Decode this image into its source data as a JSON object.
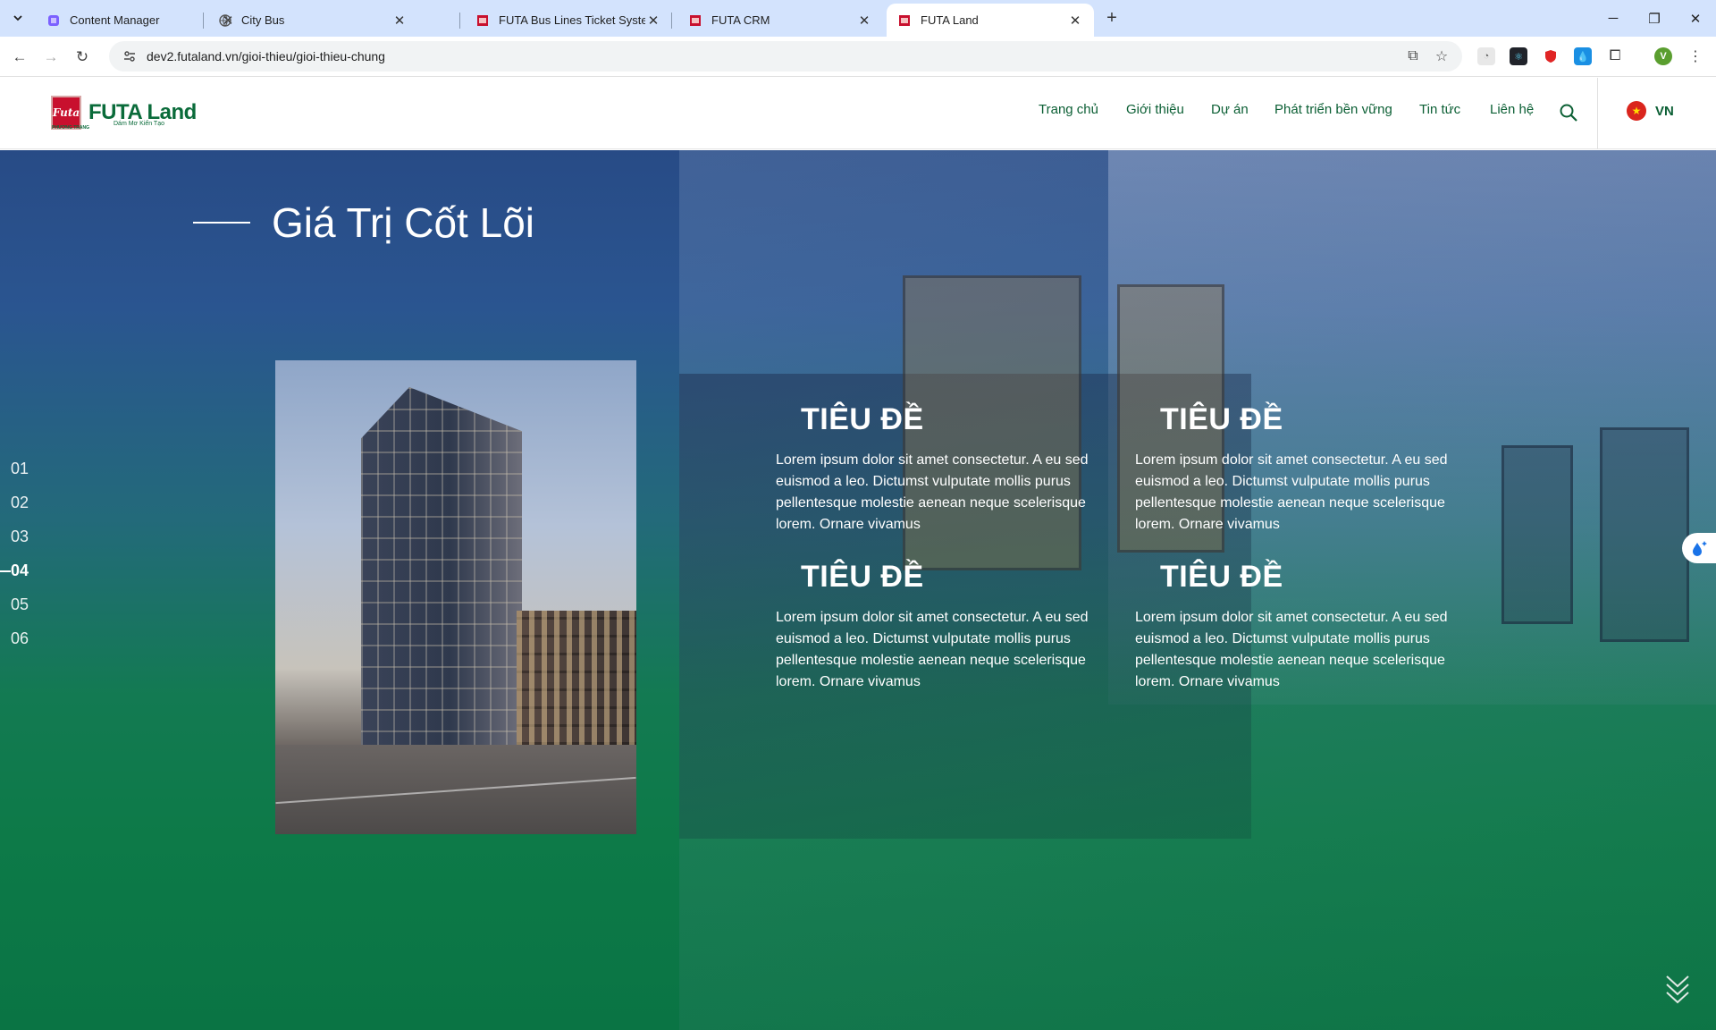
{
  "browser": {
    "tabs": [
      {
        "title": "Content Manager",
        "favicon": "content-manager-icon",
        "active": false
      },
      {
        "title": "City Bus",
        "favicon": "globe-icon",
        "active": false
      },
      {
        "title": "FUTA Bus Lines Ticket System",
        "favicon": "futa-icon",
        "active": false
      },
      {
        "title": "FUTA CRM",
        "favicon": "futa-icon",
        "active": false
      },
      {
        "title": "FUTA Land",
        "favicon": "futa-icon",
        "active": true
      }
    ],
    "url": "dev2.futaland.vn/gioi-thieu/gioi-thieu-chung",
    "profile_initial": "V"
  },
  "site": {
    "logo_text": "FUTA Land",
    "logo_mark": "Futa",
    "logo_tagline": "Dám Mơ Kiến Tạo",
    "logo_small": "PHƯƠNG TRANG",
    "nav": [
      "Trang chủ",
      "Giới thiệu",
      "Dự án",
      "Phát triển bền vững",
      "Tin tức",
      "Liên hệ"
    ],
    "language": "VN"
  },
  "hero": {
    "title": "Giá Trị Cốt Lõi",
    "steps": [
      "01",
      "02",
      "03",
      "04",
      "05",
      "06"
    ],
    "active_step": "04",
    "cards": [
      {
        "heading": "TIÊU ĐỀ",
        "body": "Lorem ipsum dolor sit amet consectetur. A eu sed euismod a leo. Dictumst vulputate mollis purus pellentesque molestie aenean neque scelerisque lorem. Ornare vivamus"
      },
      {
        "heading": "TIÊU ĐỀ",
        "body": "Lorem ipsum dolor sit amet consectetur. A eu sed euismod a leo. Dictumst vulputate mollis purus pellentesque molestie aenean neque scelerisque lorem. Ornare vivamus"
      },
      {
        "heading": "TIÊU ĐỀ",
        "body": "Lorem ipsum dolor sit amet consectetur. A eu sed euismod a leo. Dictumst vulputate mollis purus pellentesque molestie aenean neque scelerisque lorem. Ornare vivamus"
      },
      {
        "heading": "TIÊU ĐỀ",
        "body": "Lorem ipsum dolor sit amet consectetur. A eu sed euismod a leo. Dictumst vulputate mollis purus pellentesque molestie aenean neque scelerisque lorem. Ornare vivamus"
      }
    ]
  },
  "colors": {
    "brand_green": "#0b5f34",
    "hero_top": "#284b86",
    "hero_bottom": "#0a7444",
    "logo_red": "#c8102e"
  }
}
